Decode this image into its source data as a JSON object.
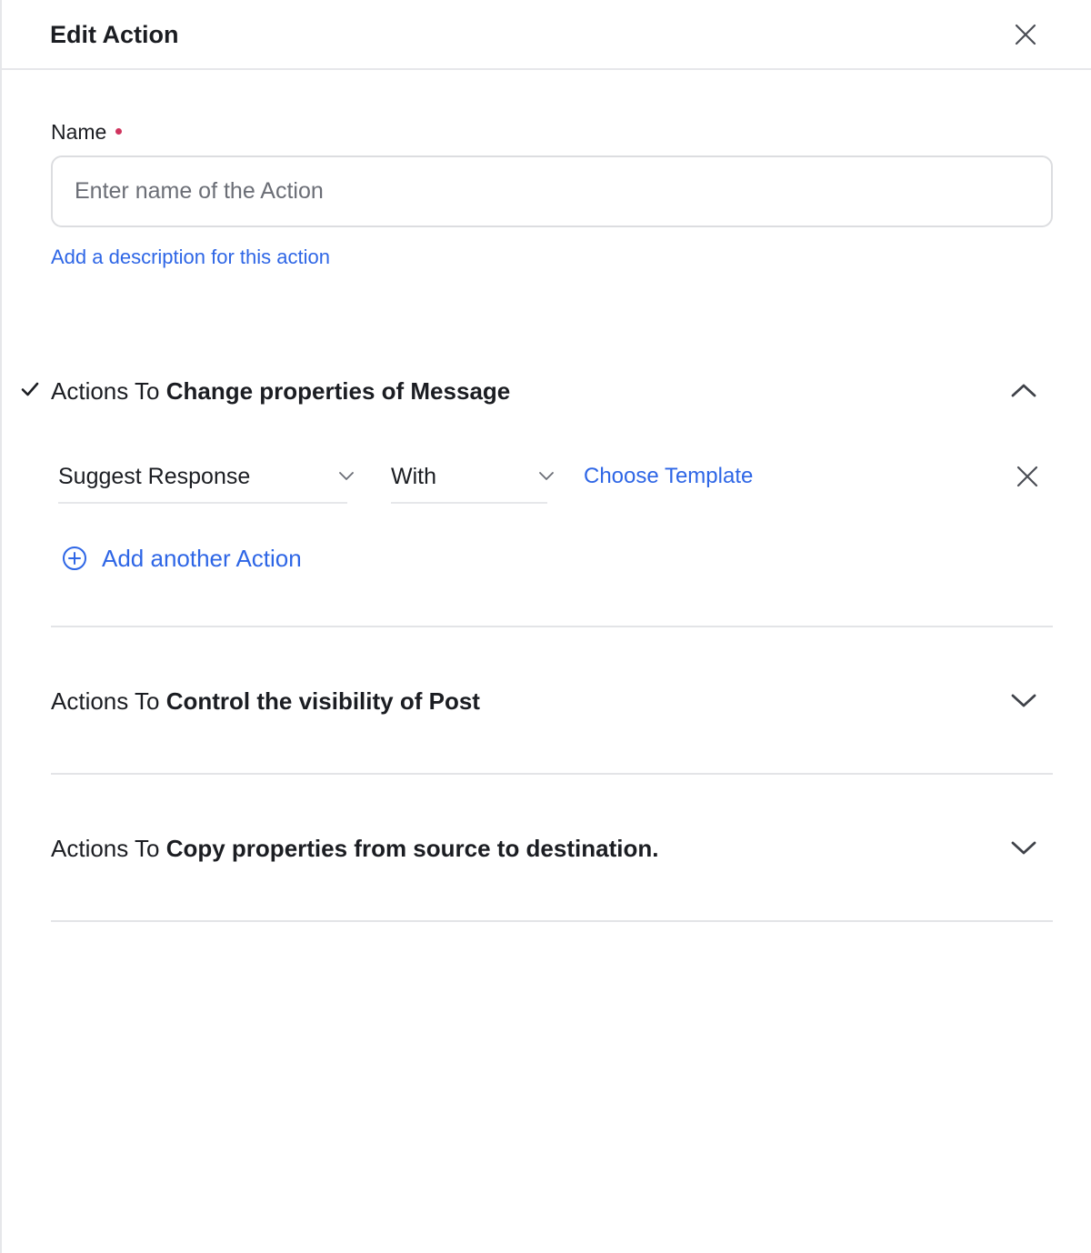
{
  "header": {
    "title": "Edit Action"
  },
  "form": {
    "name_label": "Name",
    "name_placeholder": "Enter name of the Action",
    "name_value": "",
    "description_link": "Add a description for this action"
  },
  "sections": [
    {
      "prefix": "Actions To ",
      "title": "Change properties of Message",
      "expanded": true,
      "checked": true,
      "rows": [
        {
          "action": "Suggest Response",
          "qualifier": "With",
          "link": "Choose Template"
        }
      ],
      "add_label": "Add another Action"
    },
    {
      "prefix": "Actions To ",
      "title": "Control the visibility of Post",
      "expanded": false,
      "checked": false
    },
    {
      "prefix": "Actions To ",
      "title": "Copy properties from source to destination.",
      "expanded": false,
      "checked": false
    }
  ],
  "colors": {
    "accent": "#2e66e6",
    "required": "#d0345e",
    "text": "#1b1d22",
    "border": "#e6e7ea"
  }
}
